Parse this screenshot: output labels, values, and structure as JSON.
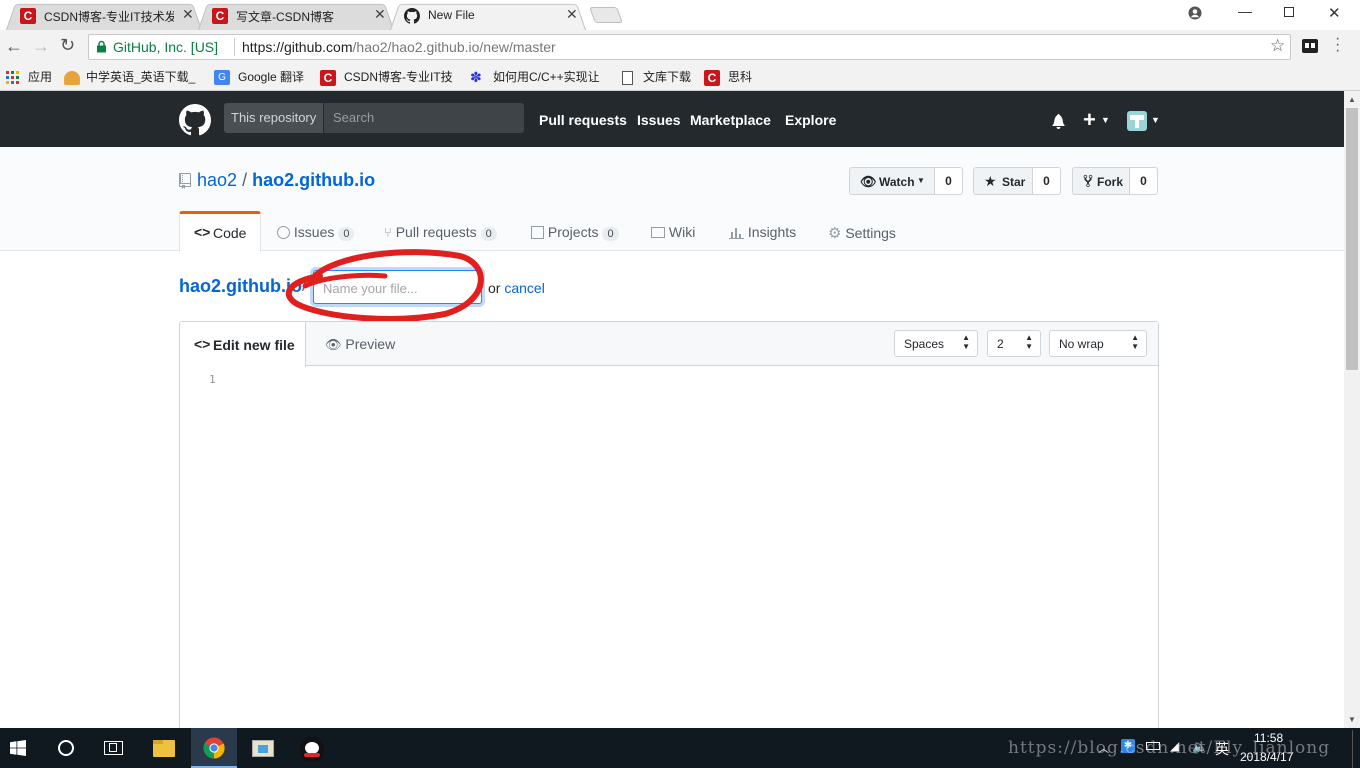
{
  "browser": {
    "tabs": [
      {
        "title": "CSDN博客-专业IT技术发",
        "active": false,
        "favicon": "csdn"
      },
      {
        "title": "写文章-CSDN博客",
        "active": false,
        "favicon": "csdn"
      },
      {
        "title": "New File",
        "active": true,
        "favicon": "github"
      }
    ],
    "security_label": "GitHub, Inc. [US]",
    "url_prefix": "https://github.com",
    "url_path": "/hao2/hao2.github.io/new/master",
    "bookmarks": [
      {
        "label": "应用",
        "icon": "apps-icon"
      },
      {
        "label": "中学英语_英语下载_",
        "icon": "pen-icon"
      },
      {
        "label": "Google 翻译",
        "icon": "translate-icon"
      },
      {
        "label": "CSDN博客-专业IT技",
        "icon": "csdn-icon"
      },
      {
        "label": "如何用C/C++实现让",
        "icon": "baidu-icon"
      },
      {
        "label": "文库下载",
        "icon": "page-icon"
      },
      {
        "label": "思科",
        "icon": "csdn-icon"
      }
    ]
  },
  "github": {
    "search_scope": "This repository",
    "search_placeholder": "Search",
    "nav": [
      "Pull requests",
      "Issues",
      "Marketplace",
      "Explore"
    ],
    "owner": "hao2",
    "separator": "/",
    "repo": "hao2.github.io",
    "watch": {
      "label": "Watch",
      "count": "0"
    },
    "star": {
      "label": "Star",
      "count": "0"
    },
    "fork": {
      "label": "Fork",
      "count": "0"
    },
    "tabs": {
      "code": "Code",
      "issues": {
        "label": "Issues",
        "count": "0"
      },
      "pulls": {
        "label": "Pull requests",
        "count": "0"
      },
      "projects": {
        "label": "Projects",
        "count": "0"
      },
      "wiki": "Wiki",
      "insights": "Insights",
      "settings": "Settings"
    },
    "breadcrumb_repo": "hao2.github.io",
    "breadcrumb_sep": "/",
    "filename_placeholder": "Name your file...",
    "or_text": "or",
    "cancel": "cancel",
    "editor": {
      "edit_tab": "Edit new file",
      "preview_tab": "Preview",
      "indent_mode": "Spaces",
      "indent_size": "2",
      "wrap_mode": "No wrap",
      "line_numbers": [
        "1"
      ]
    }
  },
  "annotation_color": "#e0201e",
  "taskbar": {
    "time": "11:58",
    "date": "2018/4/17",
    "ime": "英"
  },
  "watermark": "https://blog.csdn.net/Fly_lianlong"
}
